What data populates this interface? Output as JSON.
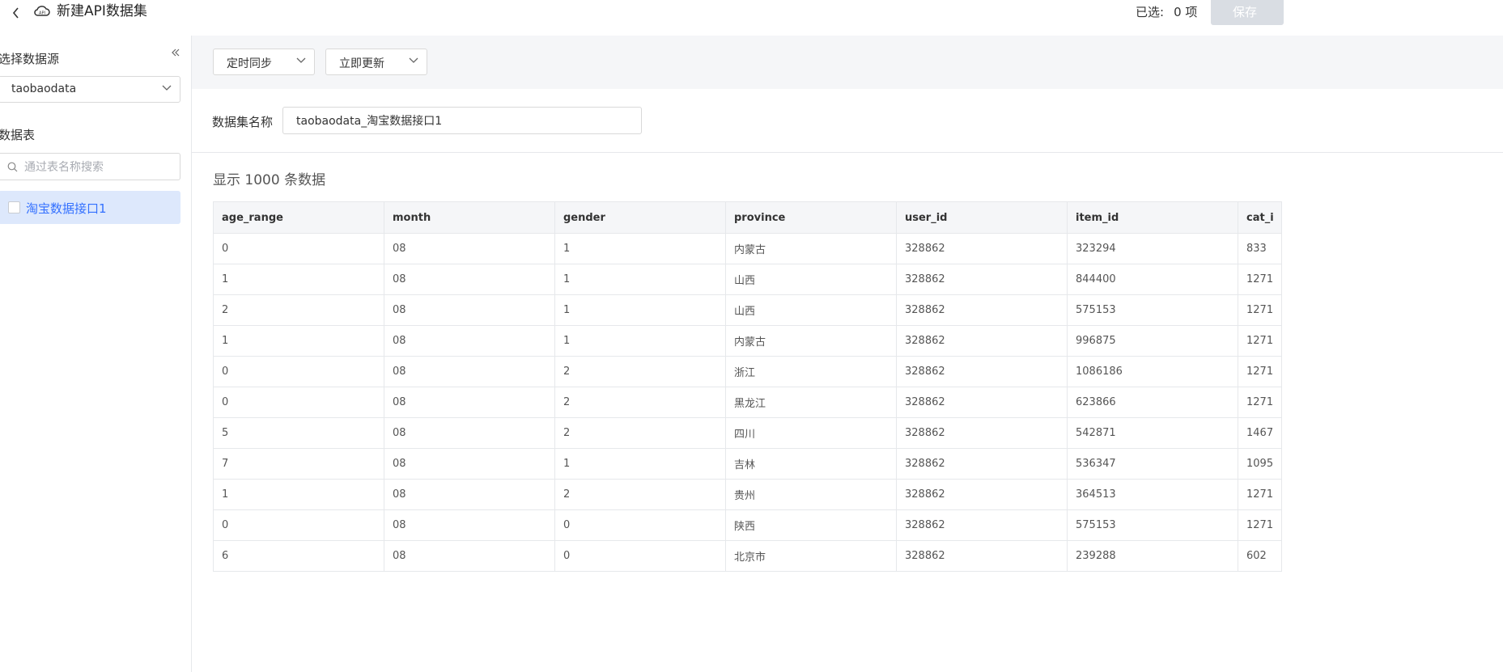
{
  "header": {
    "title": "新建API数据集",
    "selected_label": "已选:",
    "selected_count": "0 项",
    "save_label": "保存",
    "back_icon": "chevron-left-icon",
    "logo_icon": "cloud-api-icon"
  },
  "sidebar": {
    "datasource_label": "选择数据源",
    "datasource_value": "taobaodata",
    "tables_label": "数据表",
    "search_placeholder": "通过表名称搜索",
    "items": [
      {
        "label": "淘宝数据接口1",
        "checked": false
      }
    ]
  },
  "toolbar": {
    "sync_label": "定时同步",
    "update_label": "立即更新"
  },
  "dataset": {
    "name_label": "数据集名称",
    "name_value": "taobaodata_淘宝数据接口1",
    "count_text": "显示 1000 条数据"
  },
  "table": {
    "columns": [
      "age_range",
      "month",
      "gender",
      "province",
      "user_id",
      "item_id",
      "cat_i"
    ],
    "rows": [
      [
        "0",
        "08",
        "1",
        "内蒙古",
        "328862",
        "323294",
        "833"
      ],
      [
        "1",
        "08",
        "1",
        "山西",
        "328862",
        "844400",
        "1271"
      ],
      [
        "2",
        "08",
        "1",
        "山西",
        "328862",
        "575153",
        "1271"
      ],
      [
        "1",
        "08",
        "1",
        "内蒙古",
        "328862",
        "996875",
        "1271"
      ],
      [
        "0",
        "08",
        "2",
        "浙江",
        "328862",
        "1086186",
        "1271"
      ],
      [
        "0",
        "08",
        "2",
        "黑龙江",
        "328862",
        "623866",
        "1271"
      ],
      [
        "5",
        "08",
        "2",
        "四川",
        "328862",
        "542871",
        "1467"
      ],
      [
        "7",
        "08",
        "1",
        "吉林",
        "328862",
        "536347",
        "1095"
      ],
      [
        "1",
        "08",
        "2",
        "贵州",
        "328862",
        "364513",
        "1271"
      ],
      [
        "0",
        "08",
        "0",
        "陕西",
        "328862",
        "575153",
        "1271"
      ],
      [
        "6",
        "08",
        "0",
        "北京市",
        "328862",
        "239288",
        "602"
      ]
    ]
  },
  "colors": {
    "accent": "#3370ff",
    "selected_bg": "#dde8fc",
    "save_disabled": "#d9dde3"
  }
}
